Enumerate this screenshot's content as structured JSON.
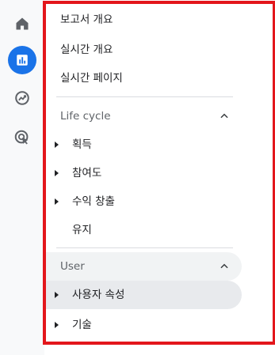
{
  "rail": {
    "icons": [
      "home-icon",
      "reports-icon",
      "explore-icon",
      "advertising-icon"
    ],
    "active_icon": "reports-icon",
    "accent_color": "#1a73e8"
  },
  "menu": {
    "top_items": [
      {
        "label": "보고서 개요"
      },
      {
        "label": "실시간 개요"
      },
      {
        "label": "실시간 페이지"
      }
    ],
    "lifecycle": {
      "title": "Life cycle",
      "expanded": true,
      "items": [
        {
          "label": "획득",
          "expandable": true
        },
        {
          "label": "참여도",
          "expandable": true
        },
        {
          "label": "수익 창출",
          "expandable": true
        },
        {
          "label": "유지",
          "expandable": false
        }
      ]
    },
    "user": {
      "title": "User",
      "expanded": true,
      "items": [
        {
          "label": "사용자 속성",
          "expandable": true,
          "selected": true
        },
        {
          "label": "기술",
          "expandable": true
        }
      ]
    }
  },
  "highlight_color": "#e3161b"
}
